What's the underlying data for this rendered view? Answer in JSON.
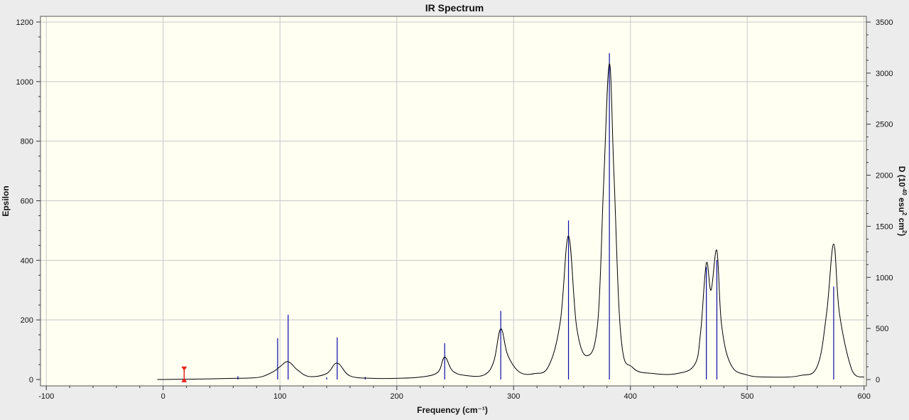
{
  "window": {
    "background": "#ececec",
    "plot_background": "#fffff2",
    "grid_color": "#c8c8c8",
    "curve_color": "#000000",
    "stick_color": "#0a0aa8",
    "marker_color": "#e82020"
  },
  "chart_data": {
    "type": "line",
    "title": "IR Spectrum",
    "xlabel": "Frequency (cm⁻¹)",
    "ylabel": "Epsilon",
    "y2label_main": "D (10",
    "y2label_sup1": "-40",
    "y2label_mid": " esu",
    "y2label_sup2": "2",
    "y2label_end": " cm",
    "y2label_sup3": "2",
    "y2label_close": ")",
    "xlim": [
      -105,
      602
    ],
    "ylim": [
      0,
      1200
    ],
    "y2lim": [
      0,
      3500
    ],
    "x_ticks": [
      -100,
      0,
      100,
      200,
      300,
      400,
      500,
      600
    ],
    "y_ticks": [
      0,
      200,
      400,
      600,
      800,
      1000,
      1200
    ],
    "y2_ticks": [
      0,
      500,
      1000,
      1500,
      2000,
      2500,
      3000,
      3500
    ],
    "grid": true,
    "legend": "none",
    "sticks": [
      {
        "x": 64,
        "y": 33
      },
      {
        "x": 98,
        "y": 405
      },
      {
        "x": 107,
        "y": 634
      },
      {
        "x": 140,
        "y": 20
      },
      {
        "x": 149,
        "y": 412
      },
      {
        "x": 173,
        "y": 25
      },
      {
        "x": 241,
        "y": 355
      },
      {
        "x": 289,
        "y": 672
      },
      {
        "x": 347,
        "y": 1557
      },
      {
        "x": 382,
        "y": 3195
      },
      {
        "x": 465,
        "y": 1102
      },
      {
        "x": 474,
        "y": 1170
      },
      {
        "x": 574,
        "y": 910
      }
    ],
    "spectrum": {
      "x": [
        -5,
        0,
        20,
        40,
        60,
        75,
        85,
        95,
        100,
        107,
        115,
        125,
        140,
        149,
        160,
        180,
        200,
        220,
        235,
        241,
        248,
        260,
        275,
        283,
        289,
        295,
        305,
        318,
        330,
        340,
        347,
        354,
        363,
        372,
        377,
        382,
        386,
        392,
        402,
        420,
        440,
        455,
        460,
        465,
        469,
        474,
        478,
        486,
        500,
        520,
        545,
        560,
        568,
        574,
        579,
        590,
        600
      ],
      "y": [
        0,
        0,
        1,
        2,
        4,
        5,
        10,
        28,
        43,
        60,
        32,
        10,
        20,
        55,
        12,
        4,
        4,
        8,
        24,
        75,
        28,
        13,
        16,
        60,
        170,
        82,
        25,
        20,
        45,
        195,
        482,
        175,
        80,
        190,
        650,
        1060,
        680,
        140,
        40,
        20,
        20,
        50,
        155,
        390,
        300,
        433,
        185,
        50,
        15,
        8,
        13,
        45,
        225,
        455,
        220,
        28,
        8
      ]
    },
    "marker": {
      "x": 18,
      "y": 10
    }
  }
}
